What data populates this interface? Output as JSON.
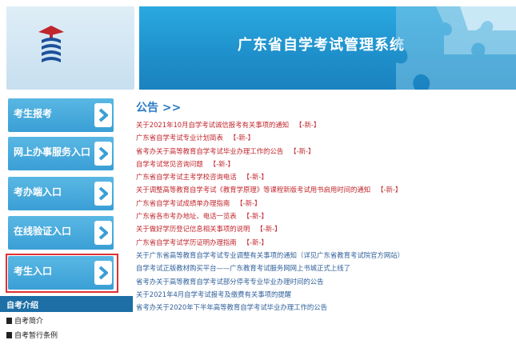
{
  "header": {
    "title": "广东省自学考试管理系统"
  },
  "sidebar": {
    "buttons": [
      {
        "label": "考生报考"
      },
      {
        "label": "网上办事服务入口"
      },
      {
        "label": "考办端入口"
      },
      {
        "label": "在线验证入口"
      },
      {
        "label": "考生入口"
      }
    ],
    "intro": {
      "heading": "自考介绍",
      "items": [
        "自考简介",
        "自考暂行条例"
      ]
    }
  },
  "main": {
    "notice_title": "公告 >>",
    "news": [
      {
        "text": "关于2021年10月自学考试诚信报考有关事项的通知",
        "tag": "【-新-】",
        "color": "red"
      },
      {
        "text": "广东省自学考试专业计划简表",
        "tag": "【-新-】",
        "color": "red"
      },
      {
        "text": "省考办关于高等教育自学考试毕业办理工作的公告",
        "tag": "【-新-】",
        "color": "red"
      },
      {
        "text": "自学考试常见咨询问题",
        "tag": "【-新-】",
        "color": "red"
      },
      {
        "text": "广东省自学考试主考学校咨询电话",
        "tag": "【-新-】",
        "color": "red"
      },
      {
        "text": "关于调整高等教育自学考试《教育学原理》等课程新版考试用书启用时间的通知",
        "tag": "【-新-】",
        "color": "red"
      },
      {
        "text": "广东省自学考试成绩单办理指南",
        "tag": "【-新-】",
        "color": "red"
      },
      {
        "text": "广东省各市考办地址、电话一览表",
        "tag": "【-新-】",
        "color": "red"
      },
      {
        "text": "关于做好学历登记信息相关事项的说明",
        "tag": "【-新-】",
        "color": "red"
      },
      {
        "text": "广东省自学考试学历证明办理指南",
        "tag": "【-新-】",
        "color": "red"
      },
      {
        "text": "关于广东省高等教育自学考试专业调整有关事项的通知（详见广东省教育考试院官方网站）",
        "tag": "",
        "color": "blue"
      },
      {
        "text": "自学考试正版教材购买平台——广东教育考试服务网网上书城正式上线了",
        "tag": "",
        "color": "blue"
      },
      {
        "text": "省考办关于高等教育自学考试部分停考专业毕业办理时间的公告",
        "tag": "",
        "color": "blue"
      },
      {
        "text": "关于2021年4月自学考试报考及缴费有关事项的提醒",
        "tag": "",
        "color": "blue"
      },
      {
        "text": "省考办关于2020年下半年高等教育自学考试毕业办理工作的公告",
        "tag": "",
        "color": "blue"
      }
    ]
  },
  "colors": {
    "banner": "#1e8fca",
    "button": "#3a9fd6",
    "highlight": "#e03030",
    "news_red": "#c0262c",
    "news_blue": "#2f5f9a",
    "notice_title": "#2b7bc4"
  }
}
